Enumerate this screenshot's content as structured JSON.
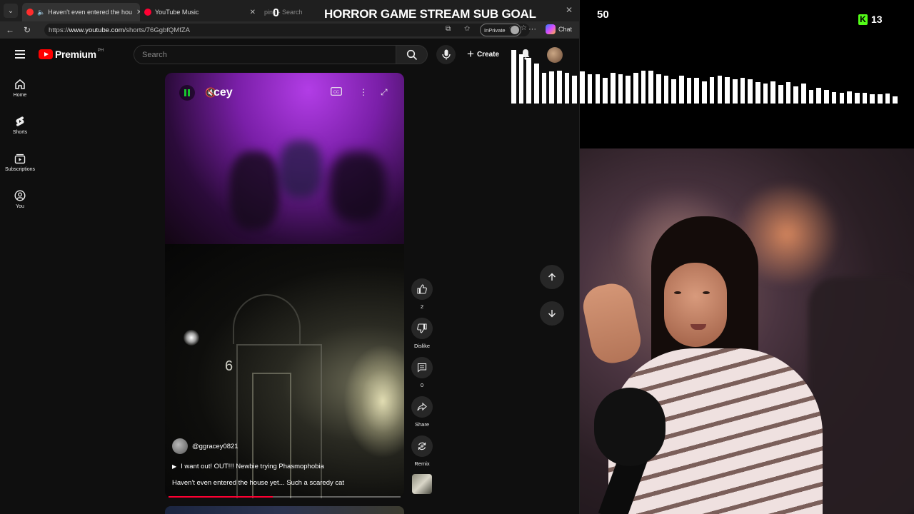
{
  "browser": {
    "tabs": [
      {
        "title": "Haven't even entered the hou",
        "close": "✕"
      },
      {
        "title": "YouTube Music",
        "close": "✕"
      },
      {
        "title": "ping - Search",
        "close": ""
      }
    ],
    "window_close": "✕",
    "url_prefix": "https://",
    "url_host": "www.youtube.com",
    "url_path": "/shorts/76GgbfQMfZA",
    "inprivate": "InPrivate",
    "more": "···",
    "chat": "Chat"
  },
  "youtube": {
    "logo_text": "Premium",
    "country": "PH",
    "search_placeholder": "Search",
    "create_label": "Create",
    "guide": [
      {
        "label": "Home",
        "icon": "home-icon"
      },
      {
        "label": "Shorts",
        "icon": "shorts-icon"
      },
      {
        "label": "Subscriptions",
        "icon": "subscriptions-icon"
      },
      {
        "label": "You",
        "icon": "you-icon"
      }
    ],
    "short": {
      "overlay_text": "cey",
      "door_number": "6",
      "channel": "@ggracey0821",
      "title": "I want out! OUT!!! Newbie trying Phasmophobia",
      "description": "Haven't even entered the house yet... Such a scaredy cat",
      "progress": 0.45
    },
    "actions": {
      "like_count": "2",
      "dislike_label": "Dislike",
      "comment_count": "0",
      "share_label": "Share",
      "remix_label": "Remix"
    }
  },
  "overlay": {
    "goal_current": "0",
    "goal_title": "HORROR GAME STREAM SUB GOAL",
    "goal_target": "50",
    "kick_letter": "K",
    "viewer_count": "13",
    "kick_color": "#53fc18",
    "visualizer_levels": [
      1.0,
      0.92,
      0.85,
      0.75,
      0.58,
      0.6,
      0.62,
      0.58,
      0.52,
      0.6,
      0.55,
      0.55,
      0.48,
      0.58,
      0.55,
      0.52,
      0.58,
      0.62,
      0.62,
      0.55,
      0.52,
      0.45,
      0.52,
      0.48,
      0.48,
      0.42,
      0.5,
      0.52,
      0.5,
      0.45,
      0.48,
      0.45,
      0.4,
      0.38,
      0.42,
      0.35,
      0.4,
      0.32,
      0.38,
      0.26,
      0.3,
      0.25,
      0.22,
      0.2,
      0.23,
      0.2,
      0.2,
      0.17,
      0.17,
      0.19,
      0.14
    ]
  }
}
